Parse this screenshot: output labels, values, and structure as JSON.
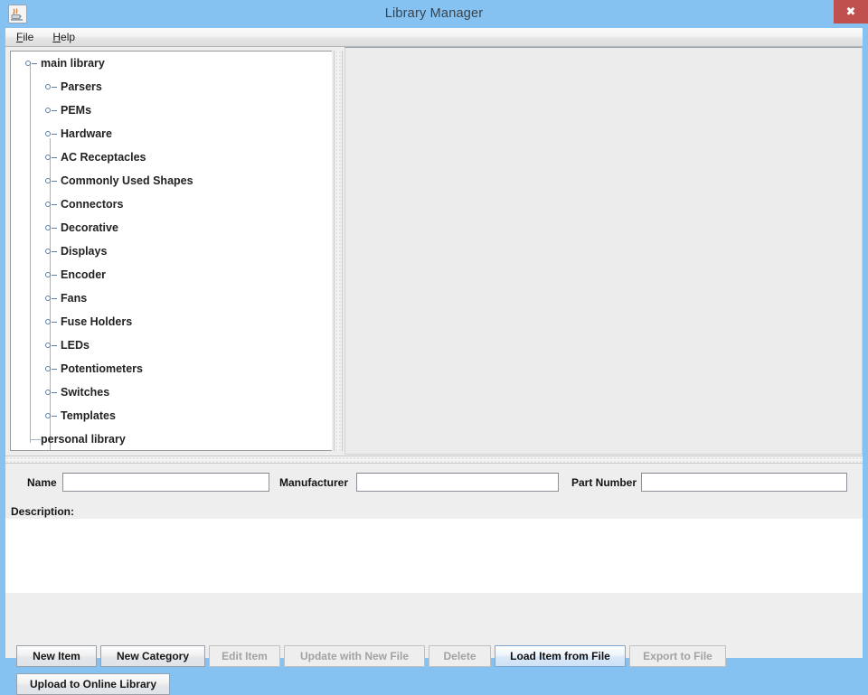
{
  "window": {
    "title": "Library Manager",
    "app_icon": "java-coffee-cup-icon",
    "close_label": "✖",
    "titlebar_color": "#85c2f2",
    "close_button_color": "#c0504d"
  },
  "menubar": {
    "items": [
      {
        "label": "File",
        "mnemonic": "F"
      },
      {
        "label": "Help",
        "mnemonic": "H"
      }
    ]
  },
  "tree": {
    "nodes": [
      {
        "label": "main library",
        "depth": 0,
        "type": "collapsed-branch"
      },
      {
        "label": "Parsers",
        "depth": 1,
        "type": "collapsed-branch"
      },
      {
        "label": "PEMs",
        "depth": 1,
        "type": "collapsed-branch"
      },
      {
        "label": "Hardware",
        "depth": 1,
        "type": "collapsed-branch"
      },
      {
        "label": "AC Receptacles",
        "depth": 1,
        "type": "collapsed-branch"
      },
      {
        "label": "Commonly Used Shapes",
        "depth": 1,
        "type": "collapsed-branch"
      },
      {
        "label": "Connectors",
        "depth": 1,
        "type": "collapsed-branch"
      },
      {
        "label": "Decorative",
        "depth": 1,
        "type": "collapsed-branch"
      },
      {
        "label": "Displays",
        "depth": 1,
        "type": "collapsed-branch"
      },
      {
        "label": "Encoder",
        "depth": 1,
        "type": "collapsed-branch"
      },
      {
        "label": "Fans",
        "depth": 1,
        "type": "collapsed-branch"
      },
      {
        "label": "Fuse Holders",
        "depth": 1,
        "type": "collapsed-branch"
      },
      {
        "label": "LEDs",
        "depth": 1,
        "type": "collapsed-branch"
      },
      {
        "label": "Potentiometers",
        "depth": 1,
        "type": "collapsed-branch"
      },
      {
        "label": "Switches",
        "depth": 1,
        "type": "collapsed-branch"
      },
      {
        "label": "Templates",
        "depth": 1,
        "type": "collapsed-branch"
      },
      {
        "label": "personal library",
        "depth": 0,
        "type": "leaf"
      }
    ]
  },
  "detail_panel": {
    "content": ""
  },
  "form": {
    "name": {
      "label": "Name",
      "value": "",
      "placeholder": ""
    },
    "manufacturer": {
      "label": "Manufacturer",
      "value": "",
      "placeholder": ""
    },
    "part_number": {
      "label": "Part Number",
      "value": "",
      "placeholder": ""
    },
    "description": {
      "label": "Description:",
      "value": "",
      "placeholder": ""
    }
  },
  "buttons": [
    {
      "label": "New Item",
      "state": "enabled"
    },
    {
      "label": "New Category",
      "state": "enabled"
    },
    {
      "label": "Edit Item",
      "state": "disabled"
    },
    {
      "label": "Update with New File",
      "state": "disabled"
    },
    {
      "label": "Delete",
      "state": "disabled"
    },
    {
      "label": "Load Item from File",
      "state": "focus"
    },
    {
      "label": "Export to File",
      "state": "disabled"
    },
    {
      "label": "Upload to Online Library",
      "state": "enabled"
    }
  ]
}
